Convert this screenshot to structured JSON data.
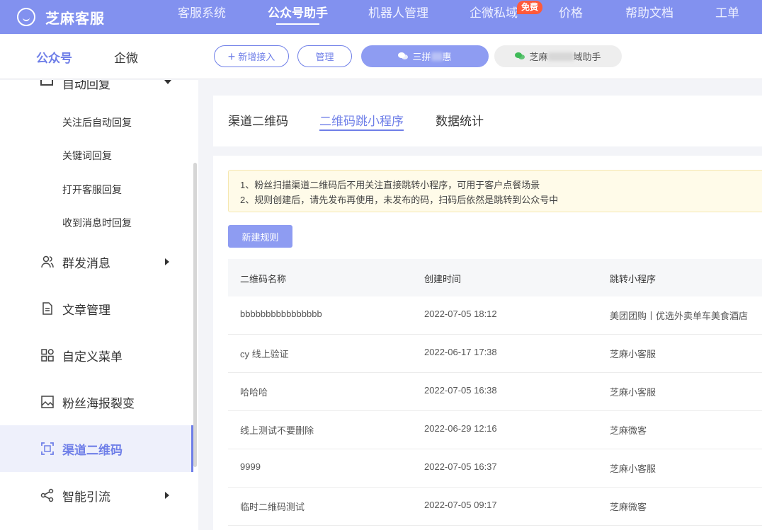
{
  "brand": {
    "name": "芝麻客服"
  },
  "topnav": {
    "items": [
      {
        "label": "客服系统"
      },
      {
        "label": "公众号助手"
      },
      {
        "label": "机器人管理"
      },
      {
        "label": "企微私域"
      },
      {
        "label": "价格"
      },
      {
        "label": "帮助文档"
      },
      {
        "label": "工单"
      }
    ],
    "badge": "免费"
  },
  "account_tabs": {
    "official": "公众号",
    "wecom": "企微"
  },
  "account_bar": {
    "add_label": "新增接入",
    "manage_label": "管理",
    "account1_label": "三拼",
    "account1_suffix": "惠",
    "account2_label": "芝麻",
    "account2_suffix": "域助手"
  },
  "sidebar": {
    "group_top": "自动回复",
    "sub_items": [
      "关注后自动回复",
      "关键词回复",
      "打开客服回复",
      "收到消息时回复"
    ],
    "items": [
      {
        "label": "群发消息"
      },
      {
        "label": "文章管理"
      },
      {
        "label": "自定义菜单"
      },
      {
        "label": "粉丝海报裂变"
      },
      {
        "label": "渠道二维码"
      },
      {
        "label": "智能引流"
      }
    ]
  },
  "content_tabs": [
    "渠道二维码",
    "二维码跳小程序",
    "数据统计"
  ],
  "notice": {
    "line1": "1、粉丝扫描渠道二维码后不用关注直接跳转小程序，可用于客户点餐场景",
    "line2": "2、规则创建后，请先发布再使用，未发布的码，扫码后依然是跳转到公众号中"
  },
  "new_rule_label": "新建规则",
  "table": {
    "headers": [
      "二维码名称",
      "创建时间",
      "跳转小程序"
    ],
    "rows": [
      [
        "bbbbbbbbbbbbbbbb",
        "2022-07-05 18:12",
        "美团团购丨优选外卖单车美食酒店"
      ],
      [
        "cy 线上验证",
        "2022-06-17 17:38",
        "芝麻小客服"
      ],
      [
        "哈哈哈",
        "2022-07-05 16:38",
        "芝麻小客服"
      ],
      [
        "线上测试不要删除",
        "2022-06-29 12:16",
        "芝麻微客"
      ],
      [
        "9999",
        "2022-07-05 16:37",
        "芝麻小客服"
      ],
      [
        "临时二维码测试",
        "2022-07-05 09:17",
        "芝麻微客"
      ]
    ]
  },
  "colors": {
    "accent": "#6f7fe8",
    "topbar": "#8291ef",
    "badge": "#ff5a3c"
  }
}
